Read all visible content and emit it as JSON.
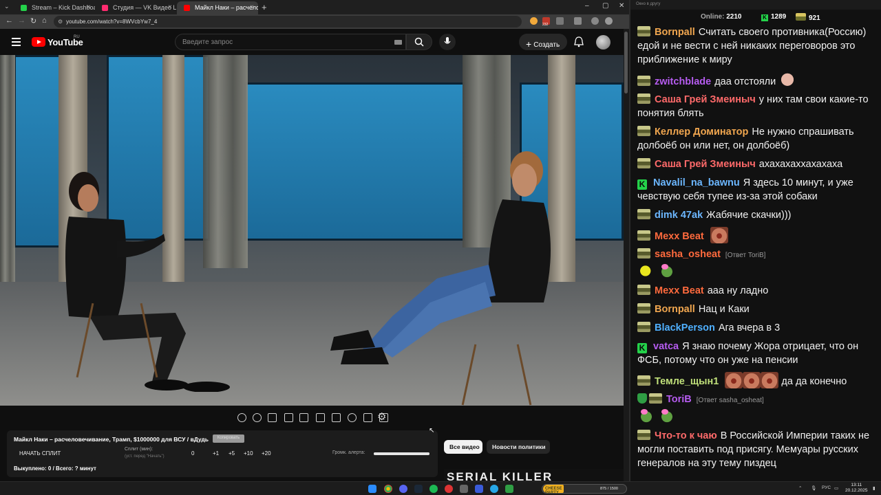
{
  "browser": {
    "tabs": [
      {
        "label": "Stream – Kick Dashboard",
        "favicon_color": "#24d24a"
      },
      {
        "label": "Студия — VK Видео Live",
        "favicon_color": "#ff2b6f"
      },
      {
        "label": "Майкл Наки – расчелове...",
        "favicon_color": "#ff0000"
      }
    ],
    "url": "youtube.com/watch?v=8WVcbYw7_4",
    "ext_badge": "232"
  },
  "youtube": {
    "logo_text": "YouTube",
    "region": "RU",
    "search_placeholder": "Введите запрос",
    "create_label": "Создать"
  },
  "panel": {
    "title": "Майкл Наки – расчеловечивание, Трамп, $1000000 для ВСУ / вДудь",
    "copy_label": "Копировать",
    "start_split": "НАЧАТЬ СПЛИТ",
    "split_label": "Сплит (мин):",
    "split_hint": "(уст. перед \"Начать\")",
    "split_value": "0",
    "steps": [
      "+1",
      "+5",
      "+10",
      "+20"
    ],
    "alert_label": "Громк. алерта:",
    "alert_level": 1.0,
    "bought": "Выкуплено: 0 / Всего: ? минут"
  },
  "chips": {
    "all_videos": "Все видео",
    "politics_news": "Новости политики"
  },
  "thumb_text": "SERIAL KILLER",
  "chat": {
    "window_title": "Окно в другу",
    "online_label": "Online:",
    "online_count": "2210",
    "kick_count": "1289",
    "other_count": "921",
    "messages": [
      {
        "badge": "gold",
        "name": "Bornpall",
        "color": "#f0a64f",
        "text": "Считать своего противника(Россию) едой и не вести с ней никаких переговоров это приближение к миру"
      },
      {
        "badge": "gold",
        "name": "zwitchblade",
        "color": "#b65cf0",
        "text": "даа отстояли",
        "emote": "bald"
      },
      {
        "badge": "gold",
        "name": "Саша Грей Змеиныч",
        "color": "#ff6a6a",
        "text": "у них там свои какие-то понятия блять"
      },
      {
        "badge": "gold",
        "name": "Келлер Доминатор",
        "color": "#f0a64f",
        "text": "Не нужно спрашивать долбоёб он или нет, он долбоёб)"
      },
      {
        "badge": "gold",
        "name": "Саша Грей Змеиныч",
        "color": "#ff6a6a",
        "text": "ахахахаххахахаха"
      },
      {
        "badge": "kick",
        "name": "Navalil_na_bawnu",
        "color": "#6cb7ff",
        "text": "Я здесь 10 минут, и уже чевствую себя тупее из-за этой собаки"
      },
      {
        "badge": "gold",
        "name": "dimk 47ak",
        "color": "#6cb7ff",
        "text": "Жабячие скачки)))"
      },
      {
        "badge": "gold",
        "name": "Mexx Beat",
        "color": "#ff6a3d",
        "text": "",
        "emote": "face"
      },
      {
        "badge": "gold",
        "name": "sasha_osheat",
        "color": "#ff6a3d",
        "reply": "[Ответ ToriB]",
        "text": "",
        "emote2": [
          "yellow",
          "frog"
        ]
      },
      {
        "badge": "gold",
        "name": "Mexx Beat",
        "color": "#ff6a3d",
        "text": "ааа ну ладно"
      },
      {
        "badge": "gold",
        "name": "Bornpall",
        "color": "#f0a64f",
        "text": "Нац и Каки"
      },
      {
        "badge": "gold",
        "name": "BlackPerson",
        "color": "#4fb0ff",
        "text": "Ага вчера в 3"
      },
      {
        "badge": "kick",
        "name": "vatca",
        "color": "#b65cf0",
        "text": "Я знаю почему Жора отрицает, что он ФСБ, потому что он уже на пенсии"
      },
      {
        "badge": "gold",
        "name": "Темле_щын1",
        "color": "#c0e07a",
        "text": "да да конечно",
        "emote3": true
      },
      {
        "badge": "shield",
        "name": "ToriB",
        "color": "#b65cf0",
        "reply": "[Ответ sasha_osheat]",
        "text": "",
        "emote2": [
          "frog",
          "frog"
        ]
      },
      {
        "badge": "gold",
        "name": "Что-то к чаю",
        "color": "#ff6a6a",
        "text": "В Российской Империи таких не могли поставить под присягу. Мемуары русских генералов на эту тему пиздец"
      }
    ]
  },
  "taskbar": {
    "widget_label": "CHEESE PARTY",
    "widget_value": "875 / 1500",
    "lang": "РУС",
    "time": "13:11",
    "date": "20.12.2025"
  }
}
